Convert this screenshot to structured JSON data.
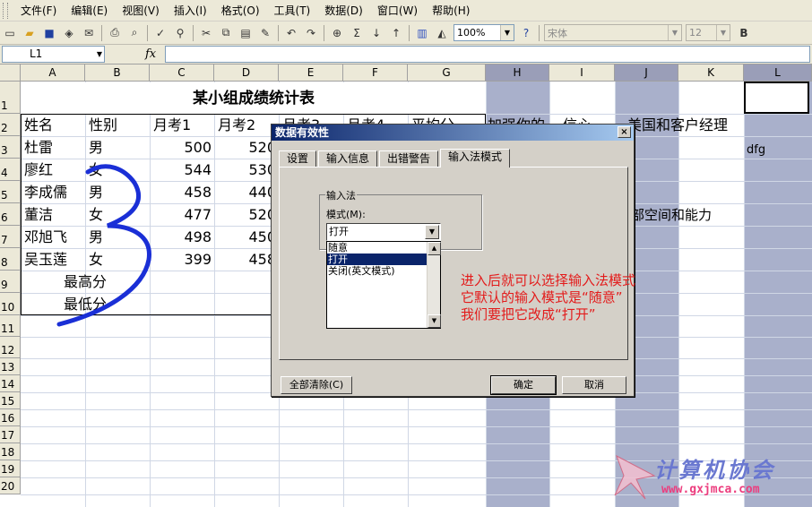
{
  "menu": [
    "文件(F)",
    "编辑(E)",
    "视图(V)",
    "插入(I)",
    "格式(O)",
    "工具(T)",
    "数据(D)",
    "窗口(W)",
    "帮助(H)"
  ],
  "toolbar": {
    "zoom": "100%",
    "font": "宋体",
    "size": "12",
    "bold": "B"
  },
  "formula": {
    "namebox": "L1",
    "fx": "fx"
  },
  "columns": [
    "A",
    "B",
    "C",
    "D",
    "E",
    "F",
    "G",
    "H",
    "I",
    "J",
    "K",
    "L"
  ],
  "rows": [
    "1",
    "2",
    "3",
    "4",
    "5",
    "6",
    "7",
    "8",
    "9",
    "10",
    "11",
    "12",
    "13",
    "14",
    "15",
    "16",
    "17",
    "18",
    "19",
    "20"
  ],
  "sheet": {
    "title": "某小组成绩统计表",
    "headers": [
      "姓名",
      "性别",
      "月考1",
      "月考2",
      "月考3",
      "月考4",
      "平均分"
    ],
    "header_h_tail": "加强你的",
    "header_i_tail": "信心",
    "header_j": "美国和客户经理",
    "l3": "dfg",
    "j6": "部空间和能力",
    "students": [
      {
        "name": "杜雷",
        "gender": "男",
        "m1": "500",
        "m2": "520"
      },
      {
        "name": "廖红",
        "gender": "女",
        "m1": "544",
        "m2": "530"
      },
      {
        "name": "李成儒",
        "gender": "男",
        "m1": "458",
        "m2": "440"
      },
      {
        "name": "董洁",
        "gender": "女",
        "m1": "477",
        "m2": "520"
      },
      {
        "name": "邓旭飞",
        "gender": "男",
        "m1": "498",
        "m2": "450"
      },
      {
        "name": "吴玉莲",
        "gender": "女",
        "m1": "399",
        "m2": "458"
      }
    ],
    "max_label": "最高分",
    "min_label": "最低分"
  },
  "dialog": {
    "title": "数据有效性",
    "close": "×",
    "tabs": [
      "设置",
      "输入信息",
      "出错警告",
      "输入法模式"
    ],
    "group_label": "输入法",
    "mode_label": "模式(M):",
    "mode_value": "打开",
    "options": [
      "随意",
      "打开",
      "关闭(英文模式)"
    ],
    "selected_option": "打开",
    "clear_button": "全部清除(C)",
    "ok_button": "确定",
    "cancel_button": "取消"
  },
  "annotation": [
    "进入后就可以选择输入法模式",
    "它默认的输入模式是“随意”",
    "我们要把它改成“打开”"
  ],
  "watermark": {
    "name": "计算机协会",
    "url": "www.gxjmca.com"
  },
  "colors": {
    "selected_column": "#a9b0cb",
    "annotation": "#e31b1b",
    "pen": "#1a2fd6"
  }
}
